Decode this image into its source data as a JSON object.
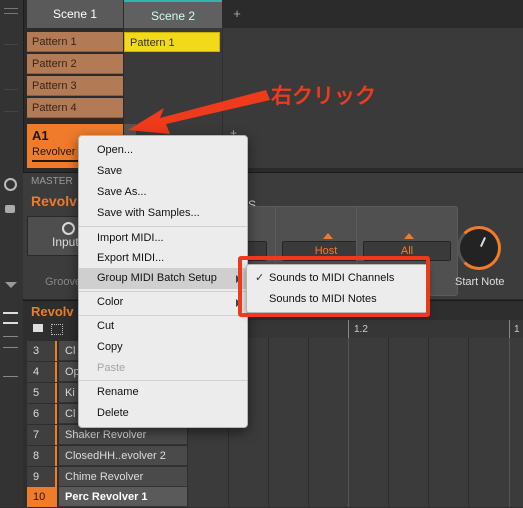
{
  "scenes": {
    "scene1": "Scene 1",
    "scene2": "Scene 2",
    "add": "+"
  },
  "patterns": [
    "Pattern 1",
    "Pattern 2",
    "Pattern 3",
    "Pattern 4"
  ],
  "scene2_pattern": "Pattern 1",
  "group": {
    "id": "A1",
    "name": "Revolver"
  },
  "master": {
    "label": "MASTER",
    "title": "Revolv",
    "input_label": "Input",
    "groove_label": "Groove",
    "param_s": "S",
    "host_button": "Host",
    "all_button": "All",
    "start_note": "Start Note"
  },
  "lower": {
    "title": "Revolv",
    "timeline_1_2": "1.2",
    "timeline_1": "1"
  },
  "sounds": [
    {
      "num": "3",
      "name": "Cl"
    },
    {
      "num": "4",
      "name": "Op"
    },
    {
      "num": "5",
      "name": "Ki"
    },
    {
      "num": "6",
      "name": "Cl"
    },
    {
      "num": "7",
      "name": "Shaker Revolver"
    },
    {
      "num": "8",
      "name": "ClosedHH..evolver 2"
    },
    {
      "num": "9",
      "name": "Chime Revolver"
    },
    {
      "num": "10",
      "name": "Perc Revolver 1"
    }
  ],
  "menu": {
    "open": "Open...",
    "save": "Save",
    "save_as": "Save As...",
    "save_with_samples": "Save with Samples...",
    "import_midi": "Import MIDI...",
    "export_midi": "Export MIDI...",
    "group_midi_batch_setup": "Group MIDI Batch Setup",
    "color": "Color",
    "cut": "Cut",
    "copy": "Copy",
    "paste": "Paste",
    "rename": "Rename",
    "delete": "Delete"
  },
  "submenu": {
    "check": "✓",
    "sounds_to_midi_channels": "Sounds to MIDI Channels",
    "sounds_to_midi_notes": "Sounds to MIDI Notes"
  },
  "annotation": "右クリック",
  "colors": {
    "accent": "#f07b2a",
    "annotation": "#ef3a1b",
    "pattern_yellow": "#f2da1a"
  }
}
